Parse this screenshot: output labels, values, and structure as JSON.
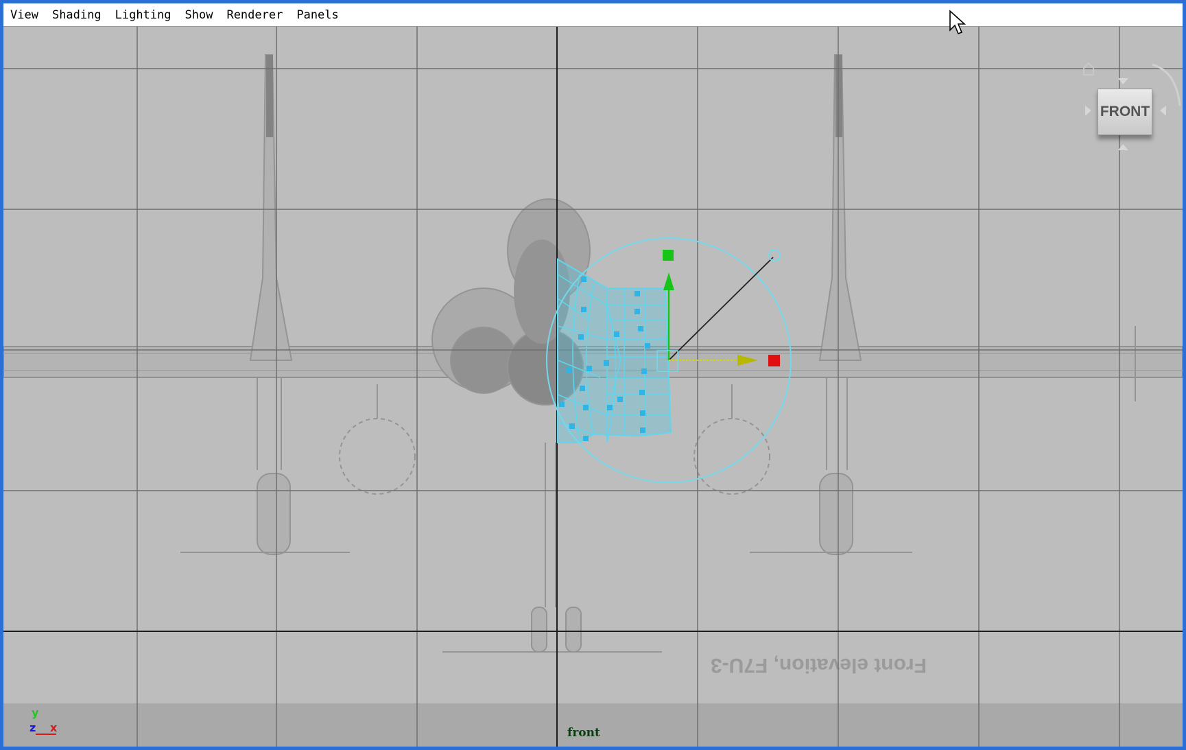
{
  "menu": {
    "items": [
      "View",
      "Shading",
      "Lighting",
      "Show",
      "Renderer",
      "Panels"
    ]
  },
  "viewport": {
    "camera_label": "front",
    "viewcube_label": "FRONT",
    "axis": {
      "y": "y",
      "z": "z",
      "x": "x"
    },
    "reference_image_caption": "Front elevation, F7U-3"
  },
  "colors": {
    "window_border": "#2b6fd6",
    "viewport_bg": "#bdbdbd",
    "selection": "#5fd6ef",
    "manip_y": "#19c419",
    "manip_x": "#e01010",
    "manip_x_arrow": "#d8d800"
  },
  "icons": {
    "cursor": "arrow-cursor-icon",
    "home": "home-icon"
  }
}
